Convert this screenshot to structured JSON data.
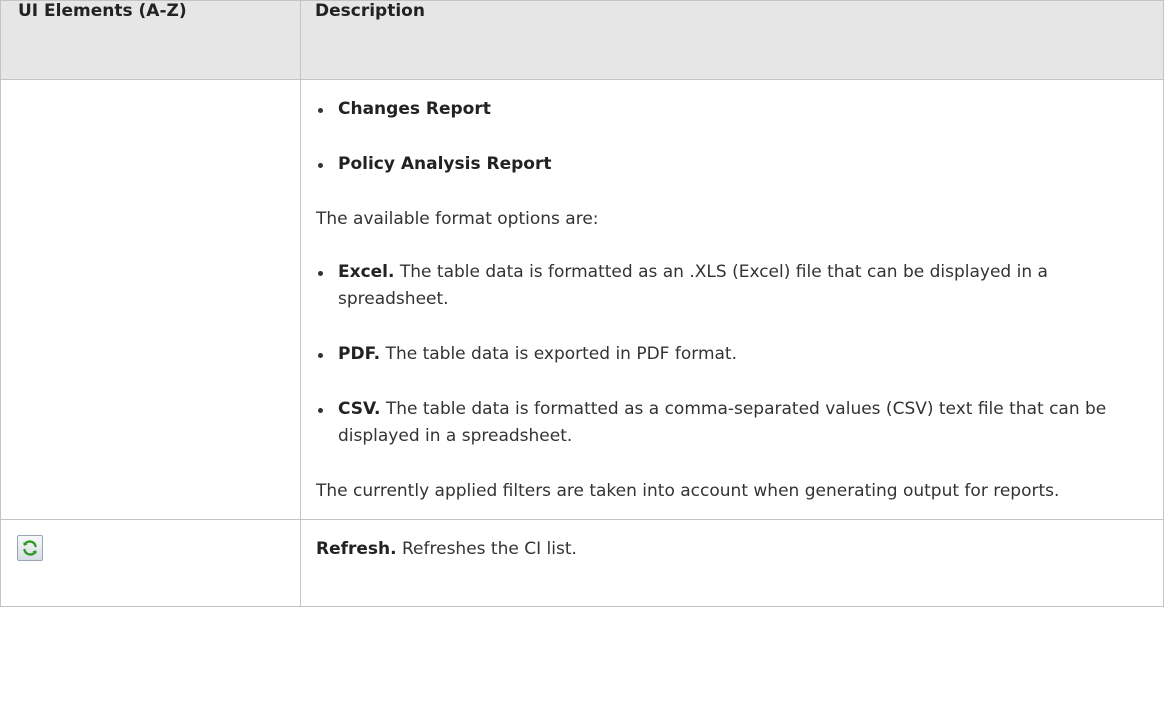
{
  "header": {
    "col1": "UI Elements (A-Z)",
    "col2": "Description"
  },
  "row_export": {
    "report_items": [
      "Changes Report",
      "Policy Analysis Report"
    ],
    "formats_intro": "The available format options are:",
    "formats": [
      {
        "name": "Excel.",
        "text": " The table data is formatted as an .XLS (Excel) file that can be displayed in a spreadsheet."
      },
      {
        "name": "PDF.",
        "text": " The table data is exported in PDF format."
      },
      {
        "name": "CSV.",
        "text": " The table data is formatted as a comma-separated values (CSV) text file that can be displayed in a spreadsheet."
      }
    ],
    "footer_note": "The currently applied filters are taken into account when generating output for reports."
  },
  "row_refresh": {
    "icon": "refresh-icon",
    "name": "Refresh.",
    "text": " Refreshes the CI list."
  },
  "colors": {
    "header_bg": "#e6e6e6",
    "border": "#c4c4c4",
    "icon_green": "#2f9a2a"
  }
}
